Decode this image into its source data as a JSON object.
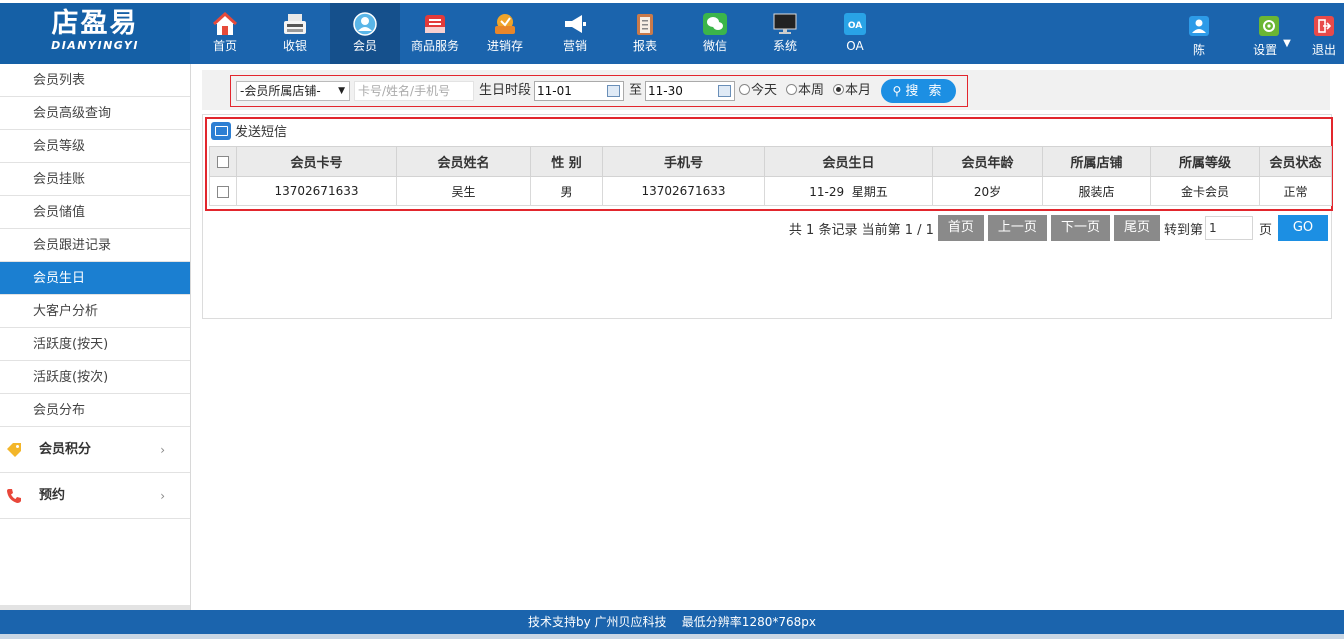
{
  "logo": {
    "cn": "店盈易",
    "en": "DIANYINGYI"
  },
  "nav": [
    {
      "label": "首页",
      "icon": "home-icon",
      "active": false
    },
    {
      "label": "收银",
      "icon": "cash-register-icon",
      "active": false
    },
    {
      "label": "会员",
      "icon": "member-icon",
      "active": true
    },
    {
      "label": "商品服务",
      "icon": "goods-icon",
      "active": false
    },
    {
      "label": "进销存",
      "icon": "inventory-icon",
      "active": false
    },
    {
      "label": "营销",
      "icon": "megaphone-icon",
      "active": false
    },
    {
      "label": "报表",
      "icon": "report-icon",
      "active": false
    },
    {
      "label": "微信",
      "icon": "wechat-icon",
      "active": false
    },
    {
      "label": "系统",
      "icon": "monitor-icon",
      "active": false
    },
    {
      "label": "OA",
      "icon": "oa-icon",
      "active": false
    }
  ],
  "right_nav": {
    "user": "陈",
    "settings": "设置",
    "logout": "退出"
  },
  "sidebar": {
    "items": [
      {
        "label": "会员列表",
        "active": false
      },
      {
        "label": "会员高级查询",
        "active": false
      },
      {
        "label": "会员等级",
        "active": false
      },
      {
        "label": "会员挂账",
        "active": false
      },
      {
        "label": "会员储值",
        "active": false
      },
      {
        "label": "会员跟进记录",
        "active": false
      },
      {
        "label": "会员生日",
        "active": true
      },
      {
        "label": "大客户分析",
        "active": false
      },
      {
        "label": "活跃度(按天)",
        "active": false
      },
      {
        "label": "活跃度(按次)",
        "active": false
      },
      {
        "label": "会员分布",
        "active": false
      }
    ],
    "groups": [
      {
        "label": "会员积分",
        "icon": "tag-icon"
      },
      {
        "label": "预约",
        "icon": "phone-icon"
      }
    ]
  },
  "search": {
    "store_select": "-会员所属店铺-",
    "keyword_placeholder": "卡号/姓名/手机号",
    "birthday_label": "生日时段",
    "date_from": "11-01",
    "to_label": "至",
    "date_to": "11-30",
    "radios": [
      {
        "label": "今天",
        "checked": false
      },
      {
        "label": "本周",
        "checked": false
      },
      {
        "label": "本月",
        "checked": true
      }
    ],
    "search_button": "搜 索"
  },
  "sms_label": "发送短信",
  "table": {
    "headers": [
      "会员卡号",
      "会员姓名",
      "性 别",
      "手机号",
      "会员生日",
      "会员年龄",
      "所属店铺",
      "所属等级",
      "会员状态"
    ],
    "rows": [
      [
        "13702671633",
        "吴生",
        "男",
        "13702671633",
        "11-29  星期五",
        "20岁",
        "服装店",
        "金卡会员",
        "正常"
      ]
    ]
  },
  "pager": {
    "info": "共 1 条记录 当前第 1 / 1",
    "first": "首页",
    "prev": "上一页",
    "next": "下一页",
    "last": "尾页",
    "goto_label": "转到第",
    "goto_value": "1",
    "page_label": "页",
    "go": "GO"
  },
  "footer": "技术支持by 广州贝应科技    最低分辨率1280*768px",
  "colors": {
    "brand": "#1b64ad",
    "accent": "#1c8fe3",
    "highlight": "#e2262d"
  }
}
